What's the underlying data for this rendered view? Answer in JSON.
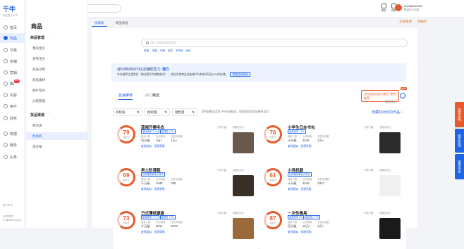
{
  "brand": {
    "name": "千牛",
    "tagline": "卖生意上千牛"
  },
  "rail": {
    "items": [
      {
        "label": "首页"
      },
      {
        "label": "商品"
      },
      {
        "label": "交易"
      },
      {
        "label": "店铺"
      },
      {
        "label": "营销"
      },
      {
        "label": "推广",
        "badge": "99+"
      },
      {
        "label": "内容"
      },
      {
        "label": "用户"
      },
      {
        "label": "财务"
      },
      {
        "label": "数据"
      },
      {
        "label": "服务"
      },
      {
        "label": "头条"
      }
    ],
    "footer": [
      "关于千牛",
      "Copyright",
      "© Alibaba Group"
    ]
  },
  "subnav": {
    "title": "商品",
    "groups": [
      {
        "label": "商品管理",
        "items": [
          "我的宝贝",
          "发布宝贝",
          "商品诊断",
          "商品素材",
          "图片空间",
          "价格管理"
        ]
      },
      {
        "label": "货品渠道",
        "items": [
          "库货源",
          "找商机",
          "淘分销"
        ]
      }
    ]
  },
  "topbar": {
    "search_placeholder": "搜索功能/商品/资讯/问答",
    "help": "帮助",
    "messages": "消息",
    "user_name": "ut1086964765",
    "user_shop": "飘香的小花园"
  },
  "page_tabs": {
    "left": [
      "找商机",
      "商品机会"
    ],
    "right": [
      "货源来源",
      "海报机"
    ]
  },
  "main": {
    "search_placeholder": "输入关键词搜索商品",
    "hot_label": "热搜:",
    "hot_words": [
      "男装",
      "内裤",
      "连衣",
      "手机壳",
      "运动"
    ],
    "info_title_prefix": "d[t1086964765] 店铺经营力:",
    "info_title_level": "潜力",
    "info_desc": "本次推荐主营类目（按近期平均销售排序），对比同类商品的店铺平均转化率高出7%的店铺。",
    "info_link": "查看经营指标",
    "tabs": [
      "蓝海推荐",
      "小二精选"
    ],
    "tip_text": "点击此处自定义类目 筛选推荐",
    "tip_dismiss": "我知道了",
    "new_tag": "NEW",
    "filters": [
      {
        "label": "商机值"
      },
      {
        "label": "搜索量"
      },
      {
        "label": "销售量"
      }
    ],
    "filter_note": "优先获取此类目下的市场机会，如您在此处添加更多类目",
    "collect_link": "收藏及对比的作品 ›"
  },
  "products": [
    {
      "score": "79",
      "score_label": "商机分",
      "name": "蓝倾开襟毛衣",
      "tags": [
        "蓝海竞争 7.1%",
        "高销售 0.2%"
      ],
      "stats": [
        {
          "k": "搜索人数",
          "v": "百万级"
        },
        {
          "k": "近月销量",
          "v": "3万+"
        },
        {
          "k": "在售商品数",
          "v": "1万+"
        }
      ],
      "link1": "查找相似",
      "link2": "货源采购",
      "meta1": "不感兴趣",
      "meta2": "收藏及对比",
      "swatch": "#6a5a4c"
    },
    {
      "score": "76",
      "score_label": "商机分",
      "name": "小学生日本书包",
      "tags": [
        "蓝海竞争 7.2%"
      ],
      "stats": [
        {
          "k": "搜索人数",
          "v": "十万级"
        },
        {
          "k": "近月销量",
          "v": "4241"
        },
        {
          "k": "在售商品数",
          "v": "3万+"
        }
      ],
      "link1": "查找相似",
      "link2": "货源采购",
      "meta1": "不感兴趣",
      "meta2": "收藏及对比",
      "swatch": "#2b2b2b"
    },
    {
      "score": "69",
      "score_label": "商机分",
      "name": "男士防滑鞋",
      "tags": [
        "近期搜索量较大增长"
      ],
      "stats": [
        {
          "k": "搜索人数",
          "v": "千万级"
        },
        {
          "k": "近月销量",
          "v": "1043"
        },
        {
          "k": "在售商品数",
          "v": "335"
        }
      ],
      "link1": "查找相似",
      "link2": "货源采购",
      "meta1": "不感兴趣",
      "meta2": "收藏及对比",
      "swatch": "#3b3026"
    },
    {
      "score": "61",
      "score_label": "商机分",
      "name": "小鸡机器",
      "tags": [
        "近期搜索量较大增长"
      ],
      "stats": [
        {
          "k": "搜索人数",
          "v": "十万级"
        },
        {
          "k": "近月销量",
          "v": "4241"
        },
        {
          "k": "在售商品数",
          "v": "2317"
        }
      ],
      "link1": "查找相似",
      "link2": "货源采购",
      "meta1": "不感兴趣",
      "meta2": "收藏及对比",
      "swatch": "#f0f0f0"
    },
    {
      "score": "73",
      "score_label": "商机分",
      "name": "日式薄纸握盘",
      "tags": [
        "蓝海竞争 7.1%",
        "高销售 7.2%"
      ],
      "stats": [
        {
          "k": "搜索人数",
          "v": "千万级"
        },
        {
          "k": "近月销量",
          "v": "5011"
        },
        {
          "k": "在售商品数",
          "v": "6374"
        }
      ],
      "link1": "查找相似",
      "link2": "货源采购",
      "meta1": "不感兴趣",
      "meta2": "收藏及对比",
      "swatch": "#9a6a3a"
    },
    {
      "score": "87",
      "score_label": "商机分",
      "name": "一次性餐具",
      "tags": [
        "蓝海竞争 2%",
        "高销售 0.7%"
      ],
      "stats": [
        {
          "k": "搜索人数",
          "v": "百万级"
        },
        {
          "k": "近月销量",
          "v": "22万+"
        },
        {
          "k": "在售商品数",
          "v": "6万+"
        }
      ],
      "link1": "查找相似",
      "link2": "货源采购",
      "meta1": "不感兴趣",
      "meta2": "收藏及对比",
      "swatch": "#1a1a1a"
    }
  ],
  "side_tabs": [
    "使用说明",
    "意见反馈",
    "使用协议"
  ],
  "colors": {
    "brand": "#1f63e6",
    "accent": "#e85a2b"
  }
}
